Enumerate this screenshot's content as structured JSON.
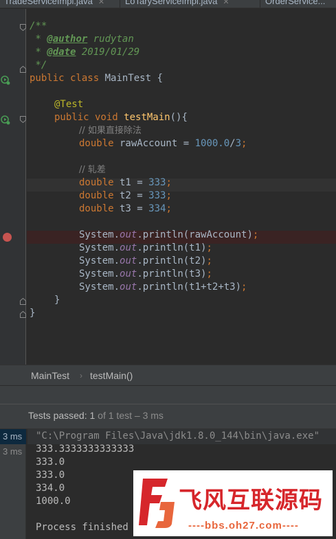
{
  "tabs": [
    {
      "label": "TradeServiceImpl.java",
      "active": false
    },
    {
      "label": "LoTaryServiceImpl.java",
      "active": false
    },
    {
      "label": "OrderService...",
      "active": false
    }
  ],
  "editor": {
    "javadoc": {
      "open": "/**",
      "star": " * ",
      "author_tag": "@author",
      "author_value": " rudytan",
      "date_tag": "@date",
      "date_value": " 2019/01/29",
      "close": " */"
    },
    "class_line": {
      "kw1": "public",
      "kw2": " class ",
      "name": "MainTest {"
    },
    "annotation": "@Test",
    "method_line": {
      "kw1": "public",
      "kw2": " void ",
      "name": "testMain",
      "rest": "(){"
    },
    "comment1": "// 如果直接除法",
    "raw_line": {
      "type": "double",
      "rest": " rawAccount = ",
      "n1": "1000.0",
      "op": "/",
      "n2": "3",
      "end": ";"
    },
    "comment2": "// 轧差",
    "t_lines": [
      {
        "type": "double",
        "rest": " t1 = ",
        "num": "333",
        "end": ";"
      },
      {
        "type": "double",
        "rest": " t2 = ",
        "num": "333",
        "end": ";"
      },
      {
        "type": "double",
        "rest": " t3 = ",
        "num": "334",
        "end": ";"
      }
    ],
    "print_lines": [
      {
        "pre": "System.",
        "field": "out",
        "post": ".println(rawAccount)",
        "end": ";"
      },
      {
        "pre": "System.",
        "field": "out",
        "post": ".println(t1)",
        "end": ";"
      },
      {
        "pre": "System.",
        "field": "out",
        "post": ".println(t2)",
        "end": ";"
      },
      {
        "pre": "System.",
        "field": "out",
        "post": ".println(t3)",
        "end": ";"
      },
      {
        "pre": "System.",
        "field": "out",
        "post": ".println(t1+t2+t3)",
        "end": ";"
      }
    ],
    "close_method": "}",
    "close_class": "}"
  },
  "breadcrumb": {
    "class_name": "MainTest",
    "separator": "›",
    "method_name": "testMain()"
  },
  "test_status": {
    "label": "Tests passed: ",
    "passed": "1",
    "of_text": " of 1 test",
    "duration": " – 3 ms"
  },
  "console": {
    "durations": [
      "3 ms",
      "3 ms"
    ],
    "lines": [
      "\"C:\\Program Files\\Java\\jdk1.8.0_144\\bin\\java.exe\"",
      "333.3333333333333",
      "333.0",
      "333.0",
      "334.0",
      "1000.0",
      "",
      "Process finished"
    ]
  },
  "watermark": {
    "title": "飞风互联源码",
    "subtitle": "----bbs.oh27.com----"
  },
  "colors": {
    "background": "#2b2b2b",
    "keyword": "#cc7832",
    "number": "#6897bb",
    "javadoc": "#629755",
    "breakpoint": "#c75450",
    "watermark_red": "#d6262b"
  }
}
